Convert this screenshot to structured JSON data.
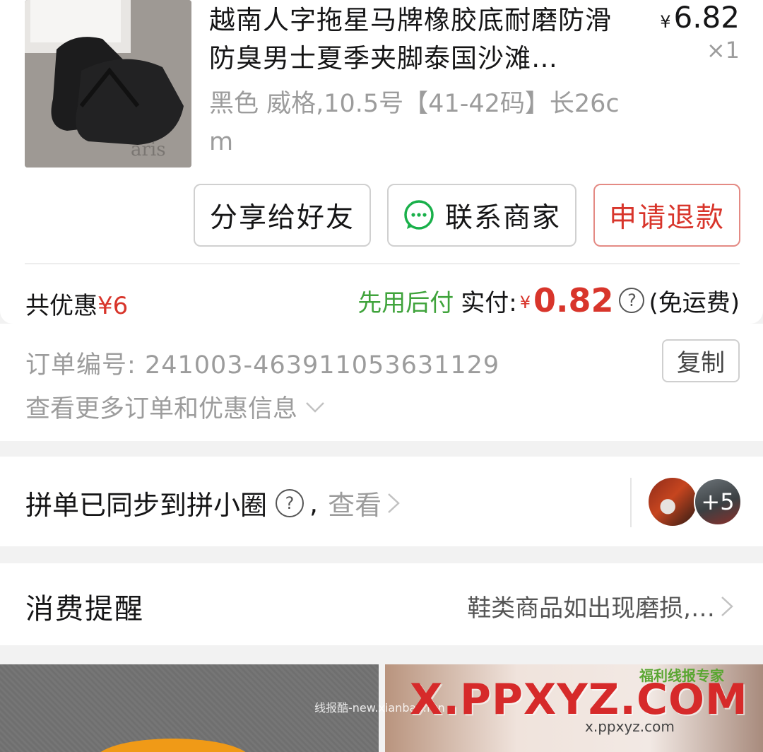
{
  "product": {
    "title": "越南人字拖星马牌橡胶底耐磨防滑防臭男士夏季夹脚泰国沙滩…",
    "price_symbol": "¥",
    "price": "6.82",
    "quantity": "×1",
    "spec": "黑色 威格,10.5号【41-42码】长26cm",
    "image_text": "aris"
  },
  "actions": {
    "share_label": "分享给好友",
    "contact_label": "联系商家",
    "refund_label": "申请退款"
  },
  "summary": {
    "saving_label": "共优惠",
    "saving_amount": "¥6",
    "pay_later_label": "先用后付",
    "paid_label": "实付:",
    "paid_symbol": "¥",
    "paid_amount": "0.82",
    "help_icon": "?",
    "shipping_note": "(免运费)"
  },
  "order_info": {
    "order_number_label": "订单编号:",
    "order_number": "241003-463911053631129",
    "copy_label": "复制",
    "more_label": "查看更多订单和优惠信息"
  },
  "group": {
    "text": "拼单已同步到拼小圈",
    "help_icon": "?",
    "separator": ",",
    "view_label": "查看",
    "extra_count": "+5"
  },
  "reminder": {
    "title": "消费提醒",
    "text": "鞋类商品如出现磨损,…"
  },
  "watermark": {
    "small": "线报酷-new.xianbao.fun",
    "big": "X.PPXYZ.COM",
    "green": "福利线报专家",
    "url": "x.ppxyz.com"
  },
  "colors": {
    "accent_red": "#d8352b",
    "pay_later_green": "#3fa33b",
    "chat_green": "#19b04a"
  }
}
